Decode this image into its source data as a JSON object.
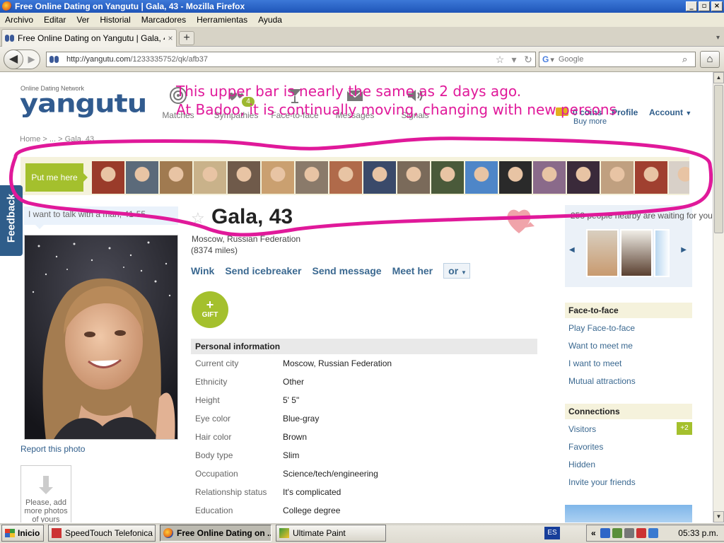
{
  "window": {
    "title": "Free Online Dating on Yangutu | Gala, 43 - Mozilla Firefox"
  },
  "menu": [
    "Archivo",
    "Editar",
    "Ver",
    "Historial",
    "Marcadores",
    "Herramientas",
    "Ayuda"
  ],
  "tab": {
    "label": "Free Online Dating on Yangutu | Gala, 43"
  },
  "address": {
    "url_host": "http://yangutu.com",
    "url_path": "/1233335752/qk/afb37"
  },
  "search": {
    "placeholder": "Google",
    "engine_glyph": "G"
  },
  "site": {
    "tagline": "Online Dating Network",
    "logo": "yangutu"
  },
  "topnav": [
    {
      "label": "Matches",
      "icon": "target-icon"
    },
    {
      "label": "Sympathies",
      "icon": "hearts-icon"
    },
    {
      "label": "Face-to-face",
      "icon": "cocktail-icon"
    },
    {
      "label": "Messages",
      "icon": "envelope-icon"
    },
    {
      "label": "Signals",
      "icon": "speaker-icon"
    }
  ],
  "sympathy_badge": "4",
  "annotation": {
    "line1": "This upper bar is nearly the same as 2 days ago.",
    "line2": "At Badoo, it is continually moving, changing with new persons"
  },
  "account_nav": {
    "coins": "0 coins",
    "buy": "Buy more",
    "profile": "Profile",
    "account": "Account"
  },
  "breadcrumb": "Home > ... > Gala, 43",
  "strip": {
    "put_me_here": "Put me here",
    "photo_count": 18
  },
  "looking_for": "I want to talk with a man, 41-55",
  "feedback": "Feedback",
  "profile": {
    "name": "Gala, 43",
    "location": "Moscow, Russian Federation",
    "distance": "(8374 miles)",
    "report": "Report this photo",
    "add_photos": "Please, add more photos of yours"
  },
  "actions": {
    "wink": "Wink",
    "icebreaker": "Send icebreaker",
    "message": "Send message",
    "meet": "Meet her",
    "or": "or"
  },
  "gift": {
    "label": "GIFT"
  },
  "personal_info": {
    "title": "Personal information",
    "rows": [
      {
        "k": "Current city",
        "v": "Moscow, Russian Federation"
      },
      {
        "k": "Ethnicity",
        "v": "Other"
      },
      {
        "k": "Height",
        "v": "5' 5\""
      },
      {
        "k": "Eye color",
        "v": "Blue-gray"
      },
      {
        "k": "Hair color",
        "v": "Brown"
      },
      {
        "k": "Body type",
        "v": "Slim"
      },
      {
        "k": "Occupation",
        "v": "Science/tech/engineering"
      },
      {
        "k": "Relationship status",
        "v": "It's complicated"
      },
      {
        "k": "Education",
        "v": "College degree"
      }
    ]
  },
  "nearby": {
    "title": "258 people nearby are waiting for you"
  },
  "face_to_face": {
    "title": "Face-to-face",
    "items": [
      "Play Face-to-face",
      "Want to meet me",
      "I want to meet",
      "Mutual attractions"
    ]
  },
  "connections": {
    "title": "Connections",
    "items": [
      "Visitors",
      "Favorites",
      "Hidden",
      "Invite your friends"
    ],
    "visitors_badge": "+2"
  },
  "taskbar": {
    "start": "Inicio",
    "tasks": [
      "SpeedTouch Telefonica ...",
      "Free Online Dating on ...",
      "Ultimate Paint"
    ],
    "lang": "ES",
    "clock": "05:33 p.m."
  },
  "colors": {
    "accent_green": "#a4c02d",
    "brand_blue": "#315b8f",
    "annotation_magenta": "#e0199a"
  }
}
